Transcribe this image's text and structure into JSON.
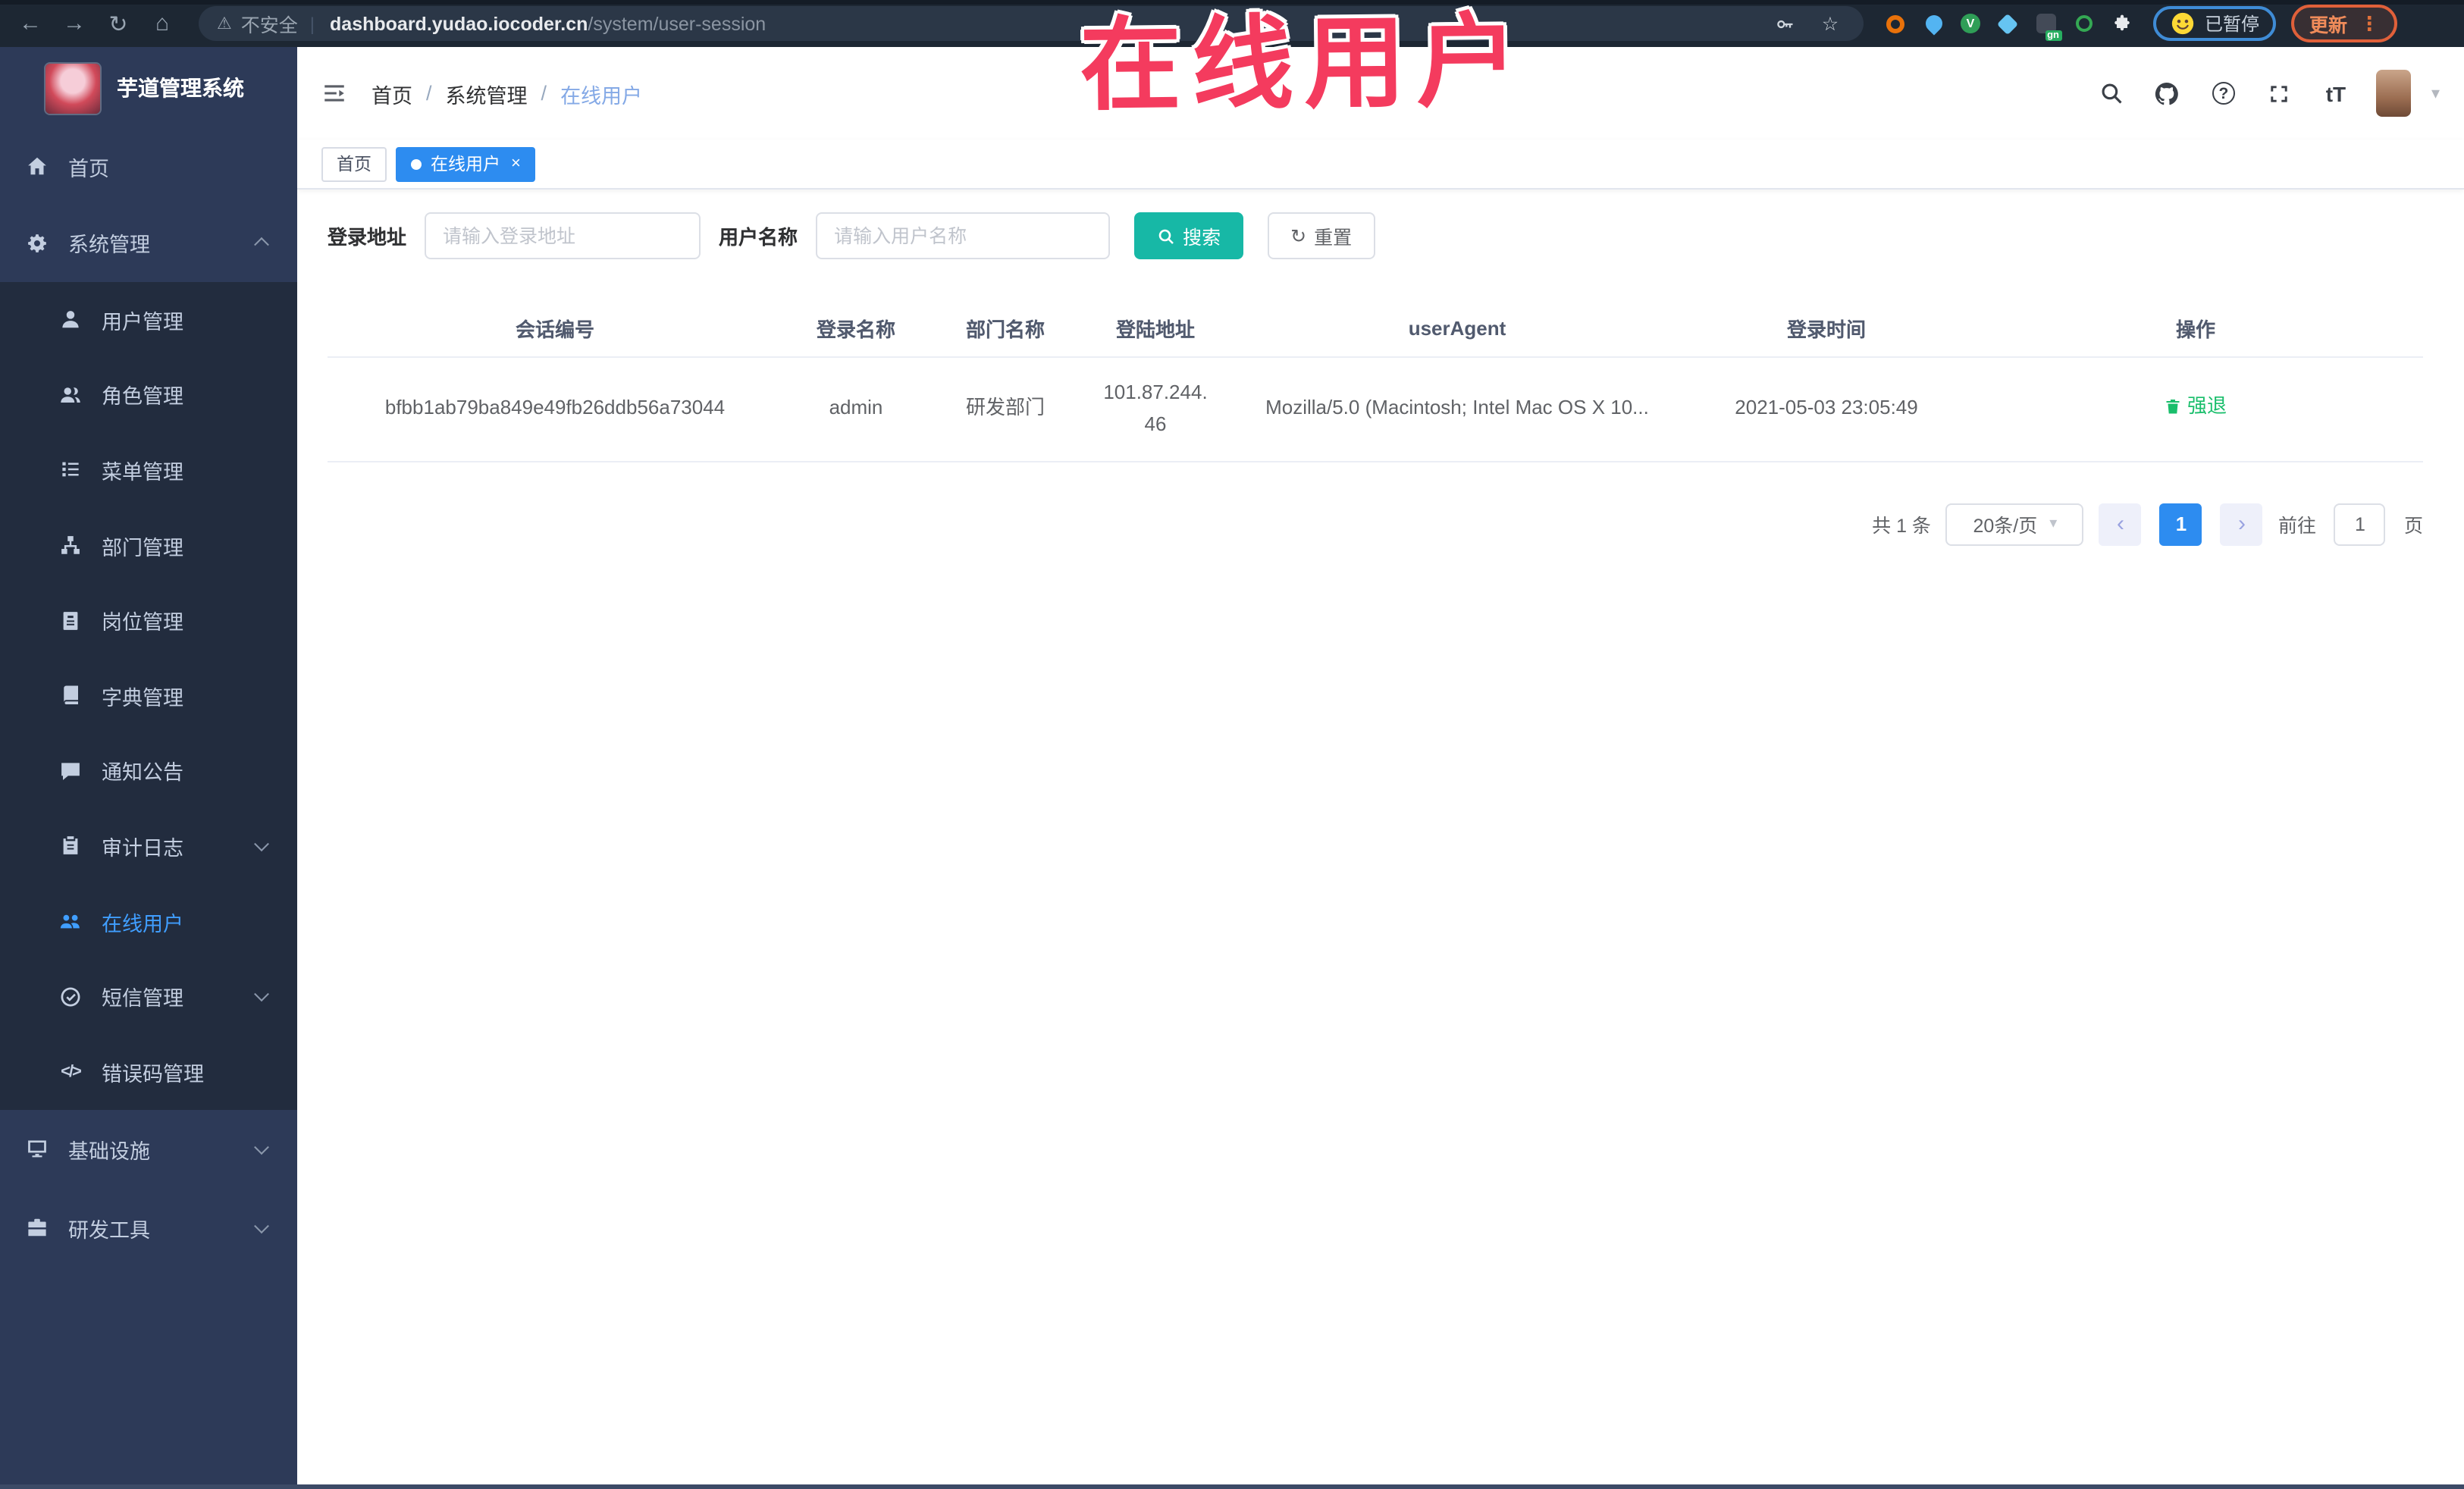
{
  "browser": {
    "security_label": "不安全",
    "url_host": "dashboard.yudao.iocoder.cn",
    "url_path": "/system/user-session",
    "paused_badge": "已暂停",
    "update_label": "更新"
  },
  "annotation": {
    "watermark": "在线用户"
  },
  "sidebar": {
    "title": "芋道管理系统",
    "items": [
      {
        "label": "首页"
      },
      {
        "label": "系统管理"
      },
      {
        "label": "用户管理"
      },
      {
        "label": "角色管理"
      },
      {
        "label": "菜单管理"
      },
      {
        "label": "部门管理"
      },
      {
        "label": "岗位管理"
      },
      {
        "label": "字典管理"
      },
      {
        "label": "通知公告"
      },
      {
        "label": "审计日志"
      },
      {
        "label": "在线用户"
      },
      {
        "label": "短信管理"
      },
      {
        "label": "错误码管理"
      },
      {
        "label": "基础设施"
      },
      {
        "label": "研发工具"
      }
    ]
  },
  "app_header": {
    "breadcrumb": [
      "首页",
      "系统管理",
      "在线用户"
    ],
    "separator": "/"
  },
  "tags": {
    "items": [
      {
        "label": "首页"
      },
      {
        "label": "在线用户"
      }
    ]
  },
  "filters": {
    "login_address_label": "登录地址",
    "login_address_placeholder": "请输入登录地址",
    "username_label": "用户名称",
    "username_placeholder": "请输入用户名称",
    "search_label": "搜索",
    "reset_label": "重置"
  },
  "table": {
    "columns": [
      "会话编号",
      "登录名称",
      "部门名称",
      "登陆地址",
      "userAgent",
      "登录时间",
      "操作"
    ],
    "rows": [
      {
        "session_id": "bfbb1ab79ba849e49fb26ddb56a73044",
        "username": "admin",
        "dept": "研发部门",
        "ip_line1": "101.87.244.",
        "ip_line2": "46",
        "user_agent": "Mozilla/5.0 (Macintosh; Intel Mac OS X 10...",
        "login_time": "2021-05-03 23:05:49",
        "action_label": "强退"
      }
    ]
  },
  "pagination": {
    "total_text": "共 1 条",
    "page_size": "20条/页",
    "current_page": "1",
    "goto_label": "前往",
    "goto_value": "1",
    "page_label": "页"
  },
  "icons": {
    "back": "←",
    "forward": "→",
    "reload": "↻",
    "home": "⌂",
    "warning": "⚠",
    "star": "☆",
    "divider": "|",
    "more": "⋮",
    "caret": "▾",
    "close": "×",
    "prev": "‹",
    "next": "›",
    "help": "?",
    "font_size": "tT",
    "code": "</>",
    "reset": "↻",
    "ext_v": "V",
    "db_badge": "gn"
  },
  "colors": {
    "accent": "#2d8cf0",
    "sidebar_active": "#409eff",
    "search_button": "#17b8a6",
    "action_green": "#19be6b",
    "watermark_red": "#f43b5e"
  }
}
